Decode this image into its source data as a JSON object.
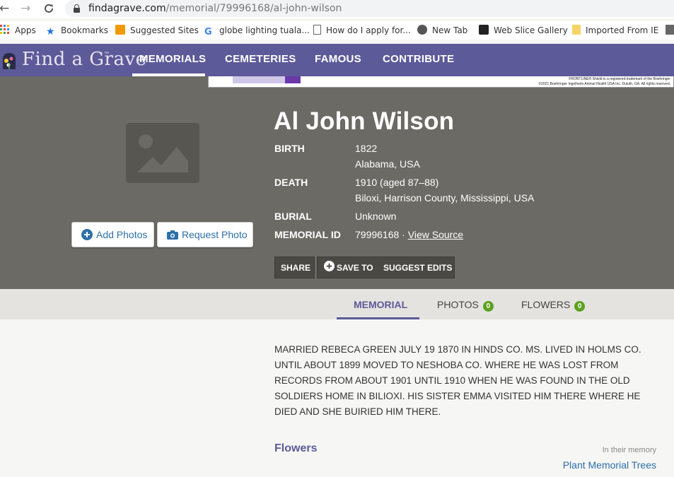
{
  "browser": {
    "url_host": "findagrave.com",
    "url_path": "/memorial/79996168/al-john-wilson",
    "bookmarks": [
      "Apps",
      "Bookmarks",
      "Suggested Sites",
      "globe lighting tuala...",
      "How do I apply for...",
      "New Tab",
      "Web Slice Gallery",
      "Imported From IE"
    ]
  },
  "site": {
    "logo_text": "Find a Grave",
    "logo_tm": "™",
    "nav": [
      "MEMORIALS",
      "CEMETERIES",
      "FAMOUS",
      "CONTRIBUTE"
    ],
    "active_nav": "MEMORIALS",
    "ad_fine_print_1": "FRONTLINE® Shield is a registered trademark of the Boehringer",
    "ad_fine_print_2": "©2021 Boehringer Ingelheim Animal Health USA Inc. Duluth, GA. All rights reserved."
  },
  "memorial": {
    "name": "Al John Wilson",
    "birth_label": "BIRTH",
    "birth_date": "1822",
    "birth_place": "Alabama, USA",
    "death_label": "DEATH",
    "death_date": "1910 (aged 87–88)",
    "death_place": "Biloxi, Harrison County, Mississippi, USA",
    "burial_label": "BURIAL",
    "burial": "Unknown",
    "id_label": "MEMORIAL ID",
    "id": "79996168",
    "id_separator": " · ",
    "view_source": "View Source"
  },
  "buttons": {
    "add_photos": "Add Photos",
    "request_photo": "Request Photo",
    "share": "SHARE",
    "save_to": "SAVE TO",
    "suggest_edits": "SUGGEST EDITS"
  },
  "tabs": {
    "memorial": "MEMORIAL",
    "photos": "PHOTOS",
    "photos_count": "0",
    "flowers": "FLOWERS",
    "flowers_count": "0"
  },
  "bio": "MARRIED REBECA GREEN JULY 19 1870 IN HINDS CO. MS. LIVED IN HOLMS CO. UNTIL ABOUT 1899 MOVED TO NESHOBA CO. WHERE HE WAS LOST FROM RECORDS FROM ABOUT 1901 UNTIL 1910 WHEN HE WAS FOUND IN THE OLD SOLDIERS HOME IN BILIOXI. HIS SISTER EMMA VISITED HIM THERE WHERE HE DIED AND SHE BUIRIED HIM THERE.",
  "flowers_section": {
    "heading": "Flowers",
    "in_their_memory": "In their memory",
    "plant_trees": "Plant Memorial Trees"
  },
  "colors": {
    "nav_purple": "#5c5a99",
    "hero_gray": "#6b6a64",
    "link_blue": "#2c6fa8",
    "badge_green": "#5ca11f"
  }
}
